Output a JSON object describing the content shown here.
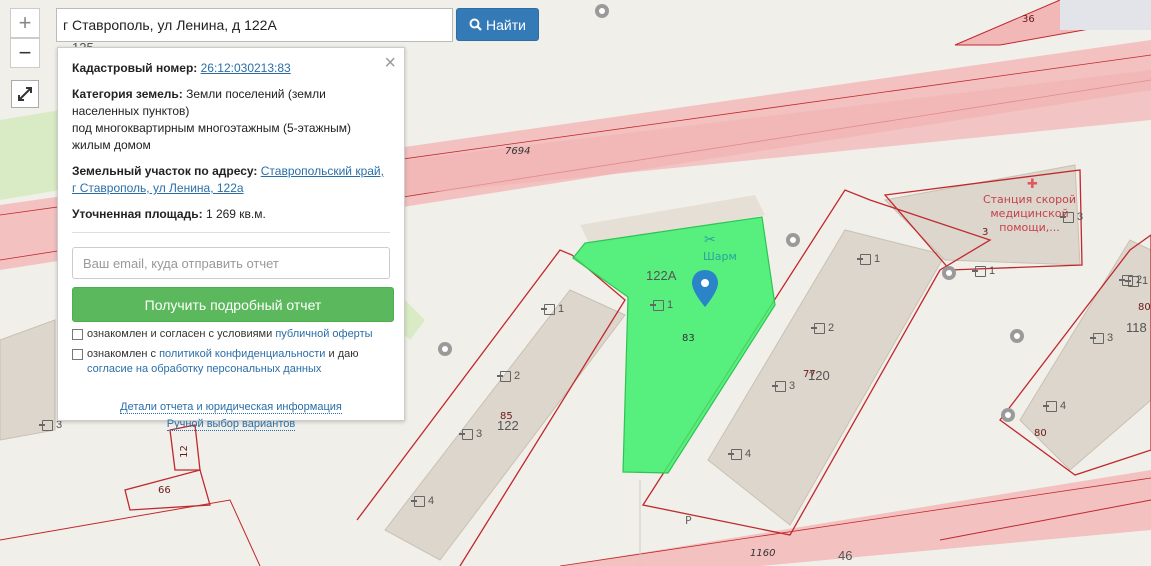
{
  "search": {
    "value": "г Ставрополь, ул Ленина, д 122А",
    "button_label": "Найти"
  },
  "zoom": {
    "plus": "+",
    "minus": "−"
  },
  "panel": {
    "cadastral_label": "Кадастровый номер:",
    "cadastral_value": "26:12:030213:83",
    "category_label": "Категория земель:",
    "category_value": "Земли поселений (земли населенных пунктов)",
    "category_use": "под многоквартирным многоэтажным (5-этажным) жилым домом",
    "address_label": "Земельный участок по адресу:",
    "address_value": "Ставропольский край, г Ставрополь, ул Ленина, 122а",
    "area_label": "Уточненная площадь:",
    "area_value": "1 269 кв.м.",
    "email_placeholder": "Ваш email, куда отправить отчет",
    "report_button": "Получить подробный отчет",
    "agree1_text": "ознакомлен и согласен с условиями",
    "agree1_link": "публичной оферты",
    "agree2_text": "ознакомлен с",
    "agree2_link": "политикой конфиденциальности",
    "agree2_mid": "и даю",
    "agree2_link2": "согласие на обработку персональных данных",
    "link_details": "Детали отчета и юридическая информация",
    "link_manual": "Ручной выбор вариантов"
  },
  "map": {
    "highlight_color": "#3cf06c",
    "parcel_border": "#c0282d",
    "road_color": "#f2b3b3",
    "labels": {
      "street_num_7694": "7694",
      "street_num_1160": "1160",
      "parcel_36": "36",
      "parcel_85": "85",
      "parcel_83": "83",
      "parcel_77": "77",
      "parcel_80a": "80",
      "parcel_80b": "80",
      "parcel_66": "66",
      "parcel_12": "12",
      "parcel_3": "3",
      "bldg_122a": "122А",
      "bldg_122": "122",
      "bldg_120": "120",
      "bldg_118": "118",
      "bldg_125": "125",
      "bldg_46": "46",
      "poi_sharm": "Шарм",
      "poi_ambulance": "Станция скорой медицинской помощи,...",
      "parking": "P"
    },
    "entrances": [
      "1",
      "1",
      "2",
      "3",
      "4",
      "1",
      "2",
      "3",
      "4",
      "1",
      "1",
      "2",
      "3",
      "4",
      "3",
      "3"
    ]
  }
}
